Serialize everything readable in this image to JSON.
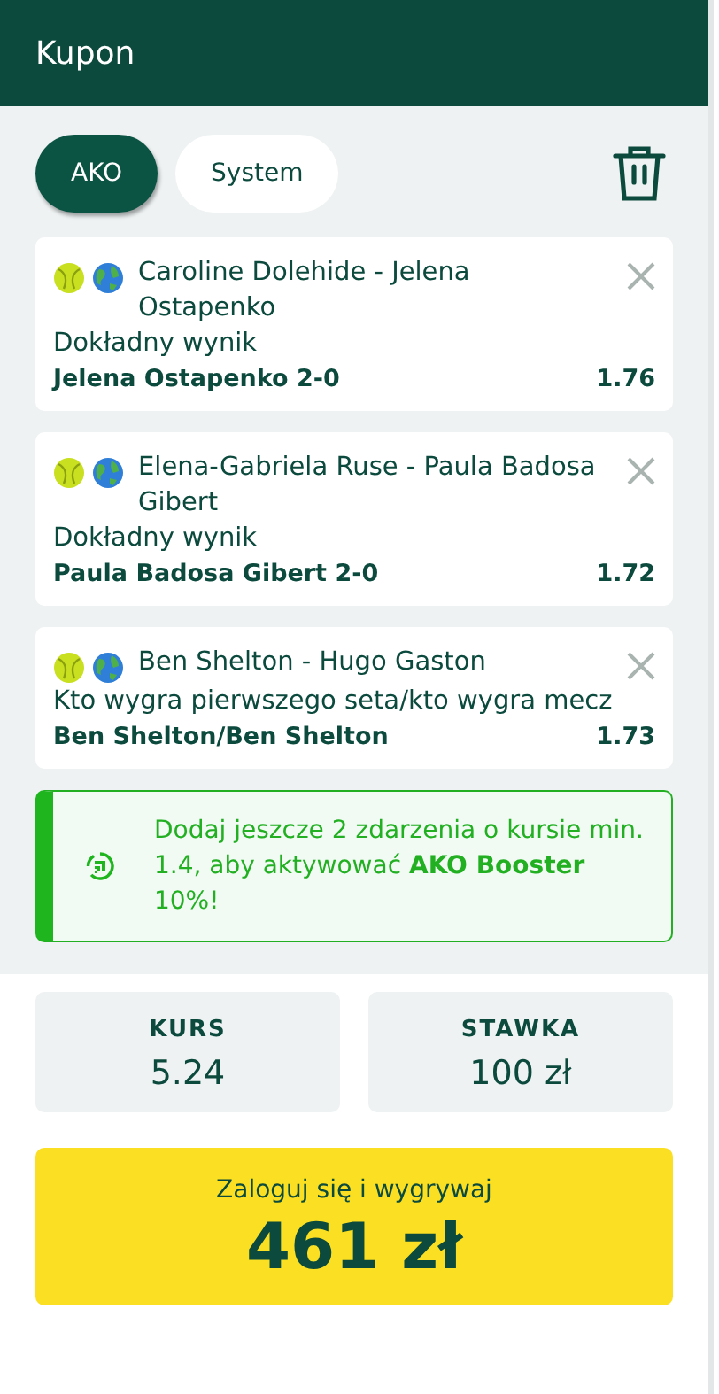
{
  "header": {
    "title": "Kupon"
  },
  "tabs": [
    {
      "label": "AKO",
      "selected": true
    },
    {
      "label": "System",
      "selected": false
    }
  ],
  "bets": [
    {
      "event": "Caroline Dolehide - Jelena Ostapenko",
      "market": "Dokładny wynik",
      "selection": "Jelena Ostapenko 2-0",
      "odds": "1.76"
    },
    {
      "event": "Elena-Gabriela Ruse - Paula Badosa Gibert",
      "market": "Dokładny wynik",
      "selection": "Paula Badosa Gibert 2-0",
      "odds": "1.72"
    },
    {
      "event": "Ben Shelton - Hugo Gaston",
      "market": "Kto wygra pierwszego seta/kto wygra mecz",
      "selection": "Ben Shelton/Ben Shelton",
      "odds": "1.73"
    }
  ],
  "booster": {
    "text": "Dodaj jeszcze 2 zdarzenia o kursie min. 1.4, aby aktywować **AKO Booster** 10%!"
  },
  "summary": [
    {
      "label": "KURS",
      "value": "5.24"
    },
    {
      "label": "STAWKA",
      "value": "100 zł"
    }
  ],
  "cta": {
    "label": "Zaloguj się i wygrywaj",
    "amount": "461 zł"
  }
}
